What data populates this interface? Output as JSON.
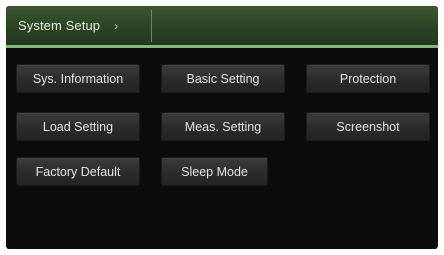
{
  "header": {
    "title": "System Setup",
    "chevron": "›",
    "accent_color": "#79c26a"
  },
  "buttons": {
    "sys_information": "Sys. Information",
    "basic_setting": "Basic Setting",
    "protection": "Protection",
    "load_setting": "Load Setting",
    "meas_setting": "Meas. Setting",
    "screenshot": "Screenshot",
    "factory_default": "Factory Default",
    "sleep_mode": "Sleep Mode"
  }
}
